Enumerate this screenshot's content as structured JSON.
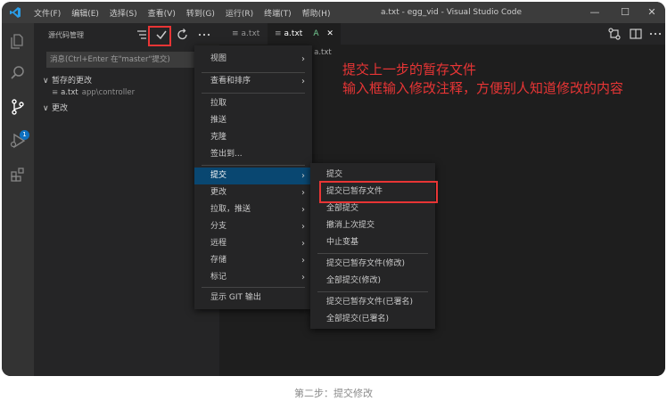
{
  "titlebar": {
    "menus": [
      "文件(F)",
      "编辑(E)",
      "选择(S)",
      "查看(V)",
      "转到(G)",
      "运行(R)",
      "终端(T)",
      "帮助(H)"
    ],
    "title": "a.txt - egg_vid - Visual Studio Code",
    "minimize": "—",
    "maximize": "☐",
    "close": "✕"
  },
  "sidebar": {
    "title": "源代码管理",
    "commit_placeholder": "消息(Ctrl+Enter 在\"master\"提交)",
    "staged_section": "暂存的更改",
    "staged_file": "a.txt",
    "staged_file_path": "app\\controller",
    "changes_section": "更改",
    "chevron": "∨"
  },
  "editor": {
    "tabs": [
      {
        "label": "a.txt",
        "status": ""
      },
      {
        "label": "a.txt",
        "status": "A"
      }
    ],
    "tab_close": "✕",
    "breadcrumb": "a.txt"
  },
  "annotation": {
    "line1": "提交上一步的暂存文件",
    "line2": "输入框输入修改注释，方便别人知道修改的内容"
  },
  "main_menu": {
    "items": [
      {
        "label": "视图",
        "submenu": true
      },
      {
        "label": "查看和排序",
        "submenu": true
      },
      {
        "label": "拉取",
        "submenu": false
      },
      {
        "label": "推送",
        "submenu": false
      },
      {
        "label": "克隆",
        "submenu": false
      },
      {
        "label": "签出到...",
        "submenu": false
      },
      {
        "label": "提交",
        "submenu": true,
        "highlight": true
      },
      {
        "label": "更改",
        "submenu": true
      },
      {
        "label": "拉取，推送",
        "submenu": true
      },
      {
        "label": "分支",
        "submenu": true
      },
      {
        "label": "远程",
        "submenu": true
      },
      {
        "label": "存储",
        "submenu": true
      },
      {
        "label": "标记",
        "submenu": true
      },
      {
        "label": "显示 GIT 输出",
        "submenu": false
      }
    ],
    "arrow": "›"
  },
  "commit_submenu": {
    "items": [
      "提交",
      "提交已暂存文件",
      "全部提交",
      "撤消上次提交",
      "中止变基",
      "提交已暂存文件(修改)",
      "全部提交(修改)",
      "提交已暂存文件(已署名)",
      "全部提交(已署名)"
    ]
  },
  "caption": "第二步：提交修改",
  "colors": {
    "accent": "#094771",
    "annotation_red": "#e83535",
    "badge_blue": "#0e70c0"
  },
  "badges": {
    "source_control_count": "1"
  }
}
